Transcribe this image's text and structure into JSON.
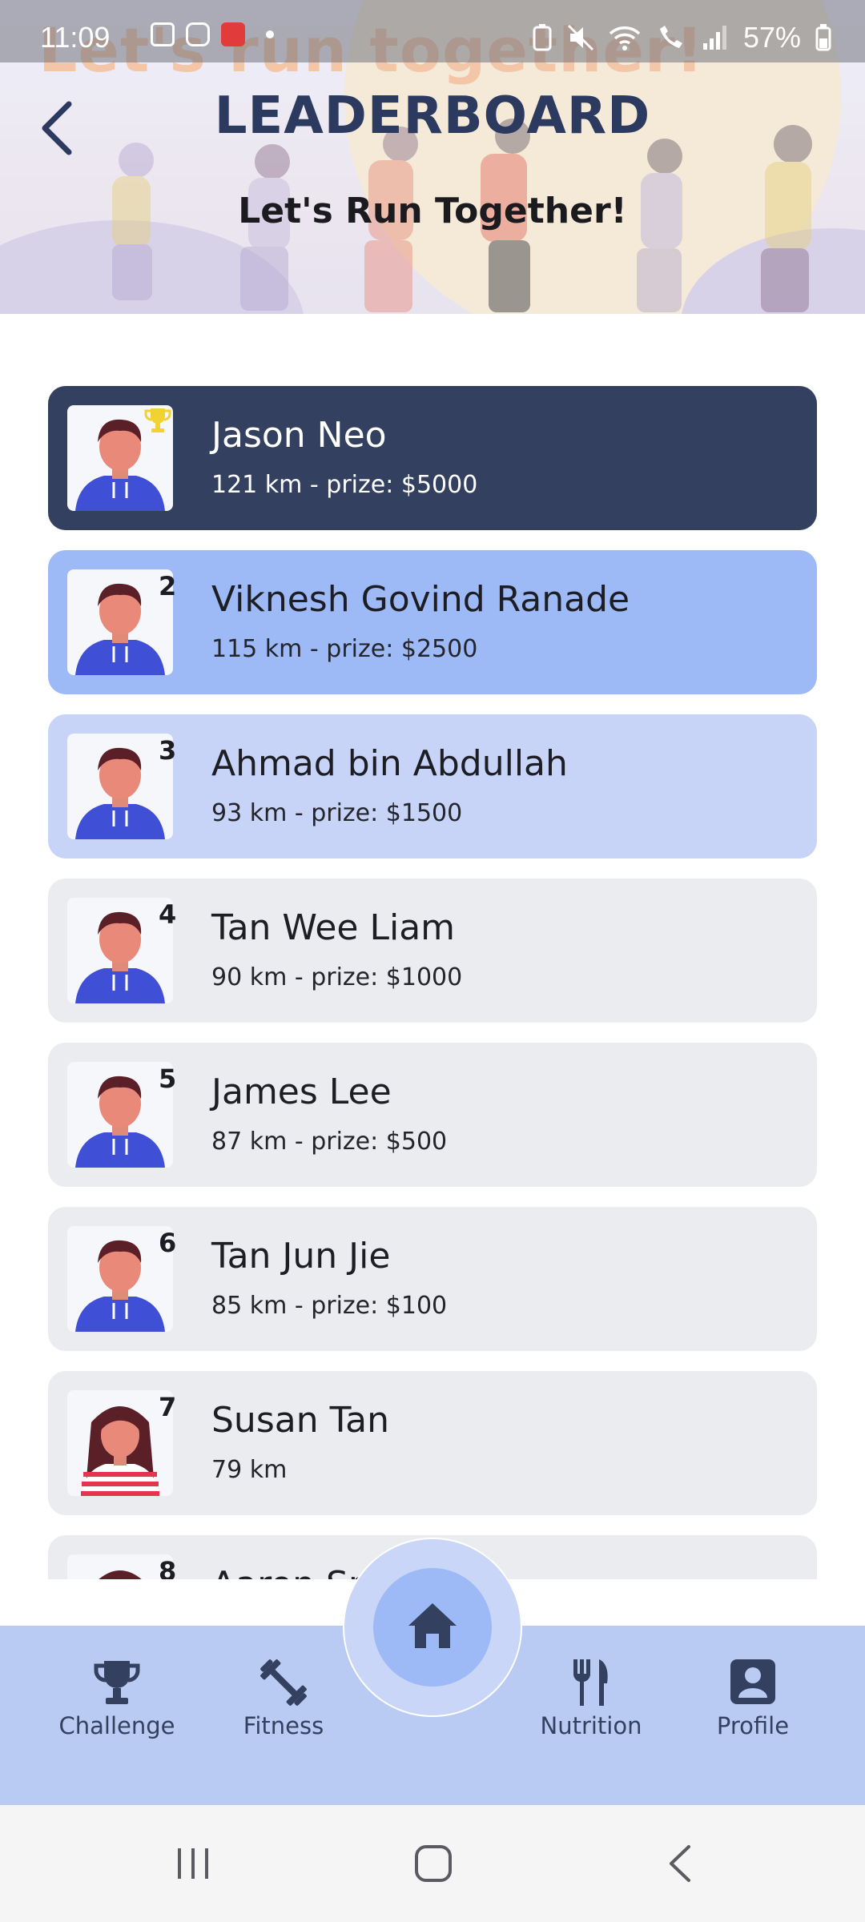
{
  "status_bar": {
    "time": "11:09",
    "battery": "57%"
  },
  "header": {
    "background_text": "Let's run together!",
    "title": "LEADERBOARD",
    "subtitle": "Let's Run Together!"
  },
  "leaderboard": [
    {
      "rank": "1",
      "rank_icon": "trophy-icon",
      "name": "Jason Neo",
      "detail": "121 km - prize: $5000",
      "avatar": "boy-avatar"
    },
    {
      "rank": "2",
      "name": "Viknesh Govind Ranade",
      "detail": "115 km - prize: $2500",
      "avatar": "boy-avatar"
    },
    {
      "rank": "3",
      "name": "Ahmad bin Abdullah",
      "detail": "93 km - prize: $1500",
      "avatar": "boy-avatar"
    },
    {
      "rank": "4",
      "name": "Tan Wee Liam",
      "detail": "90 km - prize: $1000",
      "avatar": "boy-avatar"
    },
    {
      "rank": "5",
      "name": "James Lee",
      "detail": "87 km - prize: $500",
      "avatar": "boy-avatar"
    },
    {
      "rank": "6",
      "name": "Tan Jun Jie",
      "detail": "85 km - prize: $100",
      "avatar": "boy-avatar"
    },
    {
      "rank": "7",
      "name": "Susan Tan",
      "detail": "79 km",
      "avatar": "girl-avatar"
    },
    {
      "rank": "8",
      "name": "Aaron Sn",
      "detail": "",
      "avatar": "girl-avatar"
    }
  ],
  "bottom_nav": {
    "challenge": "Challenge",
    "fitness": "Fitness",
    "home_icon": "home-icon",
    "nutrition": "Nutrition",
    "profile": "Profile"
  },
  "colors": {
    "accent_dark": "#34405f",
    "rank2": "#9dbaf7",
    "rank3": "#c7d4f8",
    "row": "#eaecef",
    "nav": "#b9cbf3"
  }
}
